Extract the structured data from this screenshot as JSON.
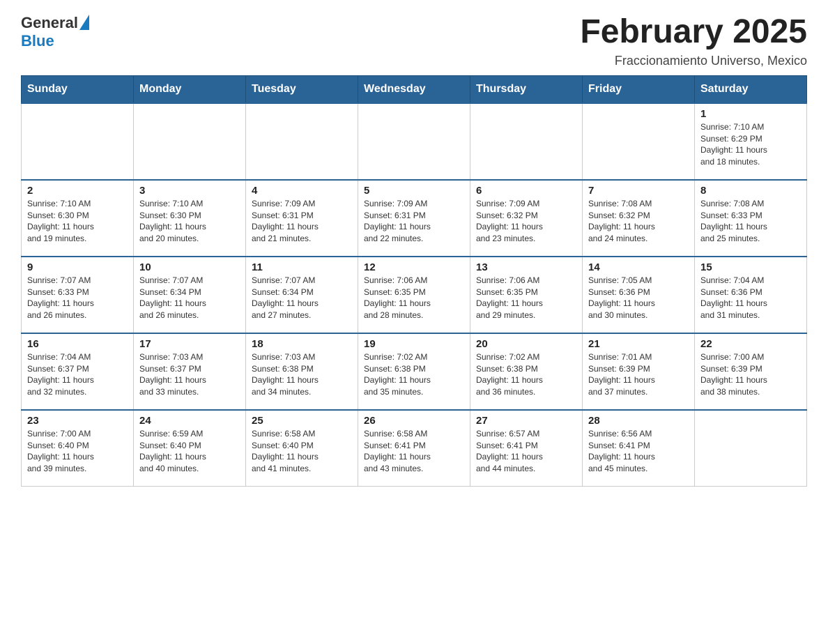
{
  "header": {
    "logo": {
      "general": "General",
      "blue": "Blue"
    },
    "title": "February 2025",
    "location": "Fraccionamiento Universo, Mexico"
  },
  "weekdays": [
    "Sunday",
    "Monday",
    "Tuesday",
    "Wednesday",
    "Thursday",
    "Friday",
    "Saturday"
  ],
  "weeks": [
    [
      {
        "day": "",
        "info": ""
      },
      {
        "day": "",
        "info": ""
      },
      {
        "day": "",
        "info": ""
      },
      {
        "day": "",
        "info": ""
      },
      {
        "day": "",
        "info": ""
      },
      {
        "day": "",
        "info": ""
      },
      {
        "day": "1",
        "info": "Sunrise: 7:10 AM\nSunset: 6:29 PM\nDaylight: 11 hours\nand 18 minutes."
      }
    ],
    [
      {
        "day": "2",
        "info": "Sunrise: 7:10 AM\nSunset: 6:30 PM\nDaylight: 11 hours\nand 19 minutes."
      },
      {
        "day": "3",
        "info": "Sunrise: 7:10 AM\nSunset: 6:30 PM\nDaylight: 11 hours\nand 20 minutes."
      },
      {
        "day": "4",
        "info": "Sunrise: 7:09 AM\nSunset: 6:31 PM\nDaylight: 11 hours\nand 21 minutes."
      },
      {
        "day": "5",
        "info": "Sunrise: 7:09 AM\nSunset: 6:31 PM\nDaylight: 11 hours\nand 22 minutes."
      },
      {
        "day": "6",
        "info": "Sunrise: 7:09 AM\nSunset: 6:32 PM\nDaylight: 11 hours\nand 23 minutes."
      },
      {
        "day": "7",
        "info": "Sunrise: 7:08 AM\nSunset: 6:32 PM\nDaylight: 11 hours\nand 24 minutes."
      },
      {
        "day": "8",
        "info": "Sunrise: 7:08 AM\nSunset: 6:33 PM\nDaylight: 11 hours\nand 25 minutes."
      }
    ],
    [
      {
        "day": "9",
        "info": "Sunrise: 7:07 AM\nSunset: 6:33 PM\nDaylight: 11 hours\nand 26 minutes."
      },
      {
        "day": "10",
        "info": "Sunrise: 7:07 AM\nSunset: 6:34 PM\nDaylight: 11 hours\nand 26 minutes."
      },
      {
        "day": "11",
        "info": "Sunrise: 7:07 AM\nSunset: 6:34 PM\nDaylight: 11 hours\nand 27 minutes."
      },
      {
        "day": "12",
        "info": "Sunrise: 7:06 AM\nSunset: 6:35 PM\nDaylight: 11 hours\nand 28 minutes."
      },
      {
        "day": "13",
        "info": "Sunrise: 7:06 AM\nSunset: 6:35 PM\nDaylight: 11 hours\nand 29 minutes."
      },
      {
        "day": "14",
        "info": "Sunrise: 7:05 AM\nSunset: 6:36 PM\nDaylight: 11 hours\nand 30 minutes."
      },
      {
        "day": "15",
        "info": "Sunrise: 7:04 AM\nSunset: 6:36 PM\nDaylight: 11 hours\nand 31 minutes."
      }
    ],
    [
      {
        "day": "16",
        "info": "Sunrise: 7:04 AM\nSunset: 6:37 PM\nDaylight: 11 hours\nand 32 minutes."
      },
      {
        "day": "17",
        "info": "Sunrise: 7:03 AM\nSunset: 6:37 PM\nDaylight: 11 hours\nand 33 minutes."
      },
      {
        "day": "18",
        "info": "Sunrise: 7:03 AM\nSunset: 6:38 PM\nDaylight: 11 hours\nand 34 minutes."
      },
      {
        "day": "19",
        "info": "Sunrise: 7:02 AM\nSunset: 6:38 PM\nDaylight: 11 hours\nand 35 minutes."
      },
      {
        "day": "20",
        "info": "Sunrise: 7:02 AM\nSunset: 6:38 PM\nDaylight: 11 hours\nand 36 minutes."
      },
      {
        "day": "21",
        "info": "Sunrise: 7:01 AM\nSunset: 6:39 PM\nDaylight: 11 hours\nand 37 minutes."
      },
      {
        "day": "22",
        "info": "Sunrise: 7:00 AM\nSunset: 6:39 PM\nDaylight: 11 hours\nand 38 minutes."
      }
    ],
    [
      {
        "day": "23",
        "info": "Sunrise: 7:00 AM\nSunset: 6:40 PM\nDaylight: 11 hours\nand 39 minutes."
      },
      {
        "day": "24",
        "info": "Sunrise: 6:59 AM\nSunset: 6:40 PM\nDaylight: 11 hours\nand 40 minutes."
      },
      {
        "day": "25",
        "info": "Sunrise: 6:58 AM\nSunset: 6:40 PM\nDaylight: 11 hours\nand 41 minutes."
      },
      {
        "day": "26",
        "info": "Sunrise: 6:58 AM\nSunset: 6:41 PM\nDaylight: 11 hours\nand 43 minutes."
      },
      {
        "day": "27",
        "info": "Sunrise: 6:57 AM\nSunset: 6:41 PM\nDaylight: 11 hours\nand 44 minutes."
      },
      {
        "day": "28",
        "info": "Sunrise: 6:56 AM\nSunset: 6:41 PM\nDaylight: 11 hours\nand 45 minutes."
      },
      {
        "day": "",
        "info": ""
      }
    ]
  ]
}
